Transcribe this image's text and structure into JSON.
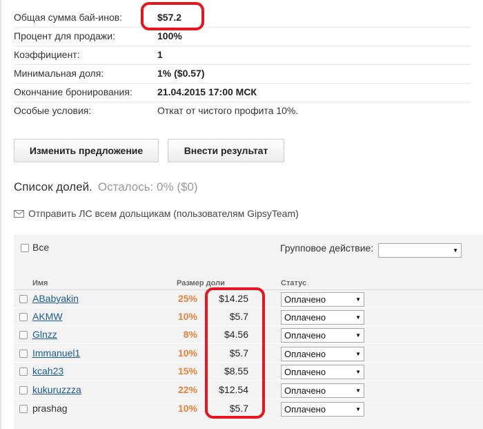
{
  "info": {
    "rows": [
      {
        "label": "Общая сумма бай-инов:",
        "value": "$57.2"
      },
      {
        "label": "Процент для продажи:",
        "value": "100%"
      },
      {
        "label": "Коэффициент:",
        "value": "1"
      },
      {
        "label": "Минимальная доля:",
        "value": "1% ($0.57)"
      },
      {
        "label": "Окончание бронирования:",
        "value": "21.04.2015 17:00 МСК"
      },
      {
        "label": "Особые условия:",
        "value": "Откат от чистого профита 10%."
      }
    ]
  },
  "buttons": {
    "edit_offer": "Изменить предложение",
    "submit_result": "Внести результат"
  },
  "shares": {
    "title": "Список долей.",
    "remaining": "Осталось: 0% ($0)",
    "mail_all": "Отправить ЛС всем дольщикам (пользователям GipsyTeam)",
    "select_all_label": "Все",
    "group_action_label": "Групповое действие:",
    "group_action_value": "",
    "columns": {
      "name": "Имя",
      "size": "Размер доли",
      "status": "Статус"
    },
    "rows": [
      {
        "name": "ABabyakin",
        "percent": "25%",
        "amount": "$14.25",
        "status": "Оплачено"
      },
      {
        "name": "AKMW",
        "percent": "10%",
        "amount": "$5.7",
        "status": "Оплачено"
      },
      {
        "name": "Glnzz",
        "percent": "8%",
        "amount": "$4.56",
        "status": "Оплачено"
      },
      {
        "name": "Immanuel1",
        "percent": "10%",
        "amount": "$5.7",
        "status": "Оплачено"
      },
      {
        "name": "kcah23",
        "percent": "15%",
        "amount": "$8.55",
        "status": "Оплачено"
      },
      {
        "name": "kukuruzzza",
        "percent": "22%",
        "amount": "$12.54",
        "status": "Оплачено"
      },
      {
        "name": "prashag",
        "percent": "10%",
        "amount": "$5.7",
        "status": "Оплачено"
      }
    ]
  },
  "colors": {
    "accent_orange": "#e8823a",
    "link_blue": "#1a5a96",
    "highlight_red": "#e8141e"
  },
  "icons": {
    "mail": "envelope-icon",
    "dropdown": "triangle-down-icon"
  }
}
